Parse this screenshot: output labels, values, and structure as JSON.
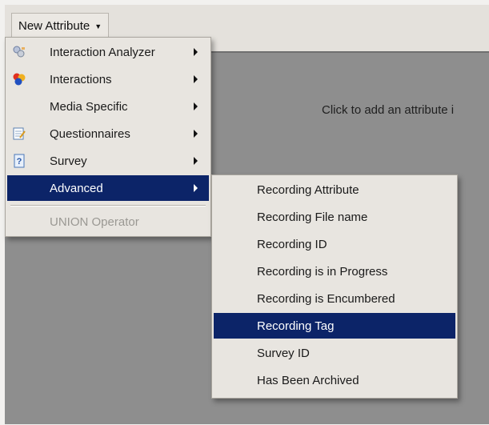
{
  "toolbar": {
    "new_attribute_label": "New Attribute"
  },
  "canvas": {
    "hint": "Click to add an attribute i"
  },
  "menu": {
    "items": [
      {
        "label": "Interaction Analyzer",
        "icon": "interaction-analyzer-icon"
      },
      {
        "label": "Interactions",
        "icon": "interactions-icon"
      },
      {
        "label": "Media Specific",
        "icon": ""
      },
      {
        "label": "Questionnaires",
        "icon": "questionnaires-icon"
      },
      {
        "label": "Survey",
        "icon": "survey-icon"
      },
      {
        "label": "Advanced",
        "icon": "",
        "selected": true
      }
    ],
    "union_label": "UNION Operator"
  },
  "submenu": {
    "items": [
      {
        "label": "Recording Attribute"
      },
      {
        "label": "Recording File name"
      },
      {
        "label": "Recording ID"
      },
      {
        "label": "Recording is in Progress"
      },
      {
        "label": "Recording is Encumbered"
      },
      {
        "label": "Recording Tag",
        "selected": true
      },
      {
        "label": "Survey ID"
      },
      {
        "label": "Has Been Archived"
      }
    ]
  },
  "colors": {
    "selection": "#0c2468",
    "menu_bg": "#e8e5e0",
    "canvas_bg": "#8e8e8e"
  }
}
